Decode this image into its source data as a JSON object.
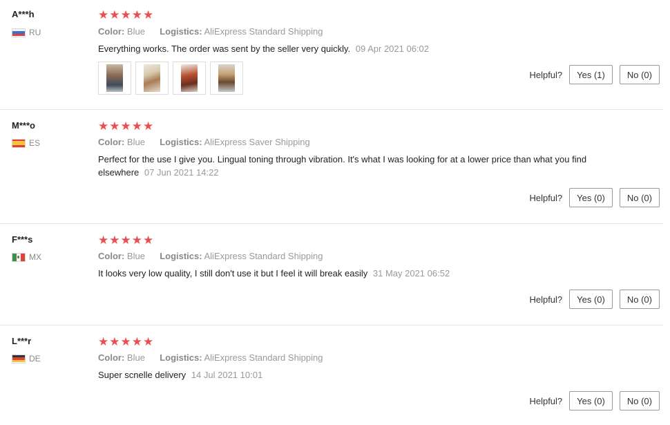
{
  "colors": {
    "star": "#eb4e4e",
    "divider": "#e8e8e8",
    "muted_text": "#999999",
    "button_border": "#999999"
  },
  "helpful_label": "Helpful?",
  "reviews": [
    {
      "user": "A***h",
      "country": "RU",
      "flag_icon": "flag-russia-icon",
      "rating": 5,
      "stars": "★★★★★",
      "color_label": "Color:",
      "color_value": "Blue",
      "logistics_label": "Logistics:",
      "logistics_value": "AliExpress Standard Shipping",
      "text": "Everything works. The order was sent by the seller very quickly.",
      "date": "09 Apr 2021 06:02",
      "photos": [
        "review-photo-1",
        "review-photo-2",
        "review-photo-3",
        "review-photo-4"
      ],
      "yes_label": "Yes (1)",
      "no_label": "No (0)"
    },
    {
      "user": "M***o",
      "country": "ES",
      "flag_icon": "flag-spain-icon",
      "rating": 5,
      "stars": "★★★★★",
      "color_label": "Color:",
      "color_value": "Blue",
      "logistics_label": "Logistics:",
      "logistics_value": "AliExpress Saver Shipping",
      "text": "Perfect for the use I give you. Lingual toning through vibration. It's what I was looking for at a lower price than what you find elsewhere",
      "date": "07 Jun 2021 14:22",
      "yes_label": "Yes (0)",
      "no_label": "No (0)"
    },
    {
      "user": "F***s",
      "country": "MX",
      "flag_icon": "flag-mexico-icon",
      "rating": 5,
      "stars": "★★★★★",
      "color_label": "Color:",
      "color_value": "Blue",
      "logistics_label": "Logistics:",
      "logistics_value": "AliExpress Standard Shipping",
      "text": "It looks very low quality, I still don't use it but I feel it will break easily",
      "date": "31 May 2021 06:52",
      "yes_label": "Yes (0)",
      "no_label": "No (0)"
    },
    {
      "user": "L***r",
      "country": "DE",
      "flag_icon": "flag-germany-icon",
      "rating": 5,
      "stars": "★★★★★",
      "color_label": "Color:",
      "color_value": "Blue",
      "logistics_label": "Logistics:",
      "logistics_value": "AliExpress Standard Shipping",
      "text": "Super scnelle delivery",
      "date": "14 Jul 2021 10:01",
      "yes_label": "Yes (0)",
      "no_label": "No (0)"
    }
  ]
}
